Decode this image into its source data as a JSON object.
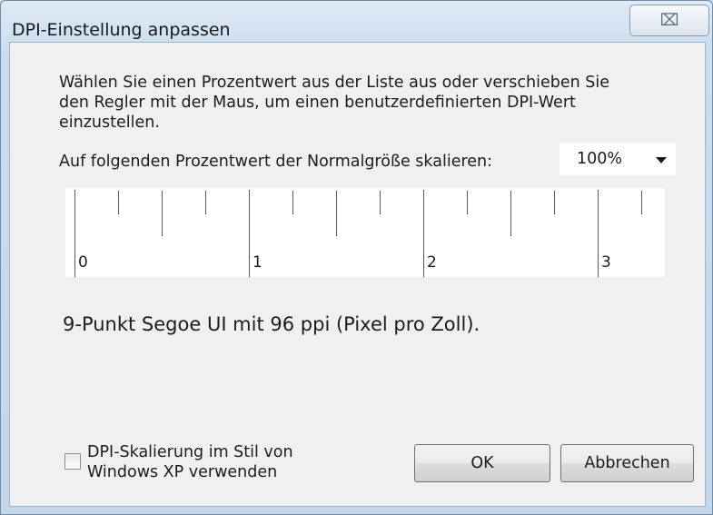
{
  "window": {
    "title": "DPI-Einstellung anpassen",
    "close_glyph": "⌧"
  },
  "description": "Wählen Sie einen Prozentwert aus der Liste aus oder verschieben Sie\nden Regler mit der Maus, um einen benutzerdefinierten DPI-Wert\neinzustellen.",
  "scale": {
    "label": "Auf folgenden Prozentwert der Normalgröße skalieren:",
    "selected": "100%"
  },
  "ruler": {
    "labels": [
      "0",
      "1",
      "2",
      "3"
    ]
  },
  "font_info": "9-Punkt Segoe UI mit 96 ppi (Pixel pro Zoll).",
  "xp_scaling": {
    "label": "DPI-Skalierung im Stil von\nWindows XP verwenden",
    "checked": false
  },
  "buttons": {
    "ok": "OK",
    "cancel": "Abbrechen"
  }
}
